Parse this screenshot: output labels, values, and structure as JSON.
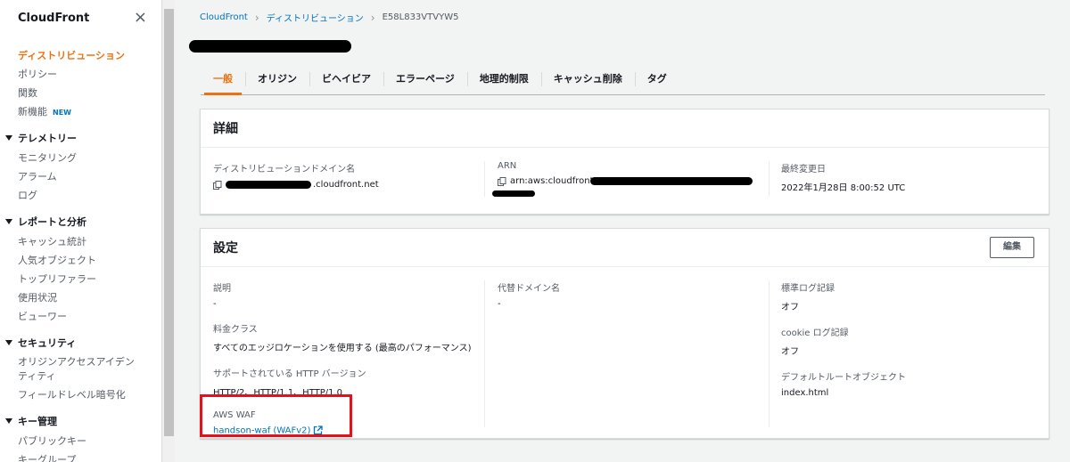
{
  "sidebar": {
    "title": "CloudFront",
    "close": "×",
    "items": [
      {
        "label": "ディストリビューション",
        "active": true
      },
      {
        "label": "ポリシー"
      },
      {
        "label": "関数"
      },
      {
        "label": "新機能",
        "badge": "NEW"
      }
    ],
    "sections": [
      {
        "title": "テレメトリー",
        "items": [
          "モニタリング",
          "アラーム",
          "ログ"
        ]
      },
      {
        "title": "レポートと分析",
        "items": [
          "キャッシュ統計",
          "人気オブジェクト",
          "トップリファラー",
          "使用状況",
          "ビューワー"
        ]
      },
      {
        "title": "セキュリティ",
        "items": [
          "オリジンアクセスアイデンティティ",
          "フィールドレベル暗号化"
        ]
      },
      {
        "title": "キー管理",
        "items": [
          "パブリックキー",
          "キーグループ"
        ]
      }
    ]
  },
  "breadcrumb": {
    "root": "CloudFront",
    "section": "ディストリビューション",
    "current": "E58L833VTVYW5"
  },
  "tabs": [
    "一般",
    "オリジン",
    "ビヘイビア",
    "エラーページ",
    "地理的制限",
    "キャッシュ削除",
    "タグ"
  ],
  "details": {
    "title": "詳細",
    "domain_label": "ディストリビューションドメイン名",
    "domain_value": ".cloudfront.net",
    "arn_label": "ARN",
    "arn_value": "arn:aws:cloudfront.",
    "modified_label": "最終変更日",
    "modified_value": "2022年1月28日 8:00:52 UTC"
  },
  "settings": {
    "title": "設定",
    "edit_label": "編集",
    "description_label": "説明",
    "description_value": "-",
    "price_label": "料金クラス",
    "price_value": "すべてのエッジロケーションを使用する (最高のパフォーマンス)",
    "http_label": "サポートされている HTTP バージョン",
    "http_value": "HTTP/2、HTTP/1.1、HTTP/1.0",
    "waf_label": "AWS WAF",
    "waf_value": "handson-waf (WAFv2)",
    "cname_label": "代替ドメイン名",
    "cname_value": "-",
    "std_log_label": "標準ログ記録",
    "std_log_value": "オフ",
    "cookie_log_label": "cookie ログ記録",
    "cookie_log_value": "オフ",
    "root_obj_label": "デフォルトルートオブジェクト",
    "root_obj_value": "index.html"
  },
  "colors": {
    "accent": "#ec7211",
    "link": "#0073bb",
    "highlight": "#e3111b"
  },
  "icons": [
    "close-icon",
    "caret-down-icon",
    "chevron-right-icon",
    "copy-icon",
    "external-link-icon"
  ]
}
